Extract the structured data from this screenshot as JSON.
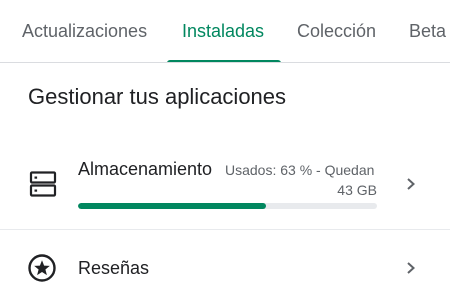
{
  "tabs": [
    {
      "label": "Actualizaciones",
      "active": false
    },
    {
      "label": "Instaladas",
      "active": true
    },
    {
      "label": "Colección",
      "active": false
    },
    {
      "label": "Beta",
      "active": false
    }
  ],
  "colors": {
    "accent": "#01875f",
    "text_primary": "#202124",
    "text_secondary": "#5f6368",
    "track": "#e8eaed"
  },
  "section": {
    "title": "Gestionar tus aplicaciones"
  },
  "storage": {
    "title": "Almacenamiento",
    "detail_line1": "Usados: 63 % - Quedan",
    "detail_line2": "43 GB",
    "used_fraction": 0.63,
    "icon": "storage-icon",
    "chevron_icon": "chevron-right-icon"
  },
  "reviews": {
    "label": "Reseñas",
    "icon": "star-circle-icon",
    "chevron_icon": "chevron-right-icon"
  }
}
